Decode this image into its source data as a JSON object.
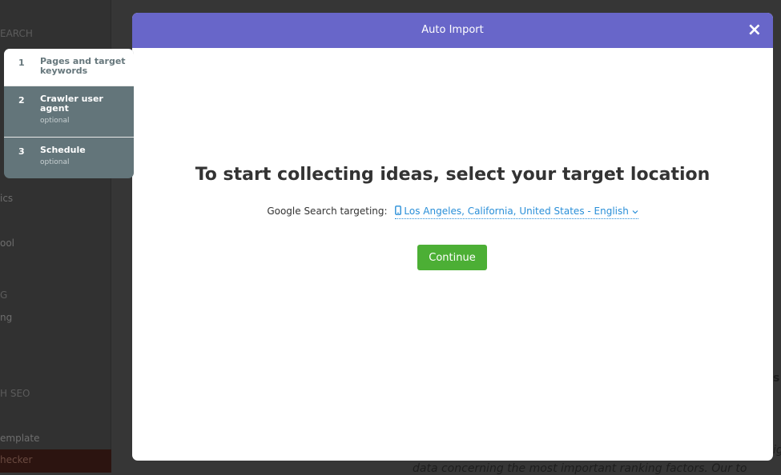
{
  "background": {
    "sidebar_fragments": [
      "EARCH",
      "ics",
      "ool",
      "G",
      "ng",
      "H SEO",
      "emplate",
      "hecker"
    ],
    "main_fragments": [
      "s",
      "ig",
      "data concerning the most important ranking factors. Our to"
    ]
  },
  "steps": [
    {
      "number": "1",
      "label": "Pages and target keywords",
      "sub": ""
    },
    {
      "number": "2",
      "label": "Crawler user agent",
      "sub": "optional"
    },
    {
      "number": "3",
      "label": "Schedule",
      "sub": "optional"
    }
  ],
  "modal": {
    "title": "Auto Import",
    "close_icon": "×",
    "heading": "To start collecting ideas, select your target location",
    "targeting_label": "Google Search targeting:",
    "location": "Los Angeles, California, United States - English",
    "continue_label": "Continue"
  },
  "colors": {
    "header": "#6866c9",
    "continue": "#4caf35",
    "link": "#2a8fd8"
  }
}
